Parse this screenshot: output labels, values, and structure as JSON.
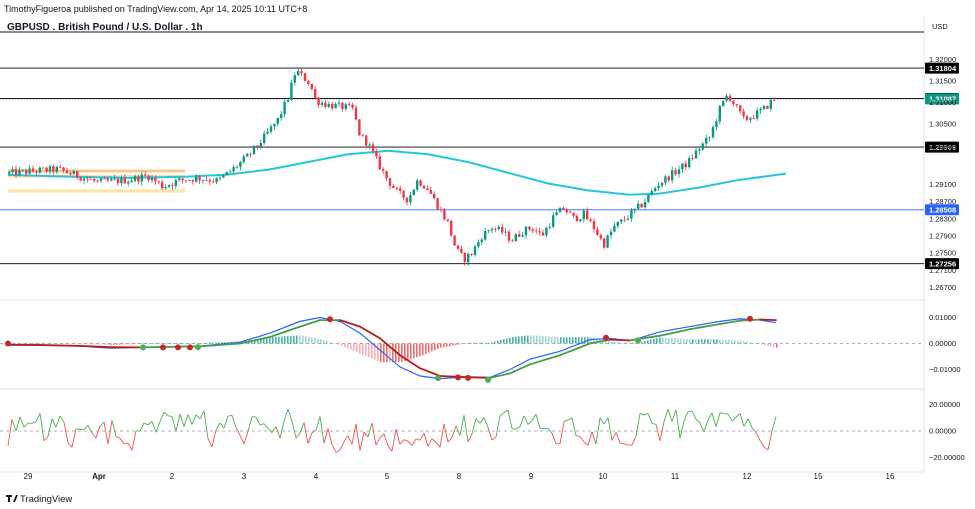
{
  "publisher_text": "TimothyFigueroa published on TradingView.com, Apr 14, 2025 10:11 UTC+8",
  "branding": {
    "logo_text": "TradingView",
    "logo_icon": "tradingview-logo-icon"
  },
  "chart_data": [
    {
      "type": "candlestick",
      "title": "GBPUSD . British Pound / U.S. Dollar . 1h",
      "currency_label": "USD",
      "yticks": [
        "1.32000",
        "1.31500",
        "1.31000",
        "1.30500",
        "1.29950",
        "1.29100",
        "1.28700",
        "1.28300",
        "1.27900",
        "1.27500",
        "1.27100",
        "1.26700"
      ],
      "ylim": [
        1.2655,
        1.3255
      ],
      "price_levels": [
        {
          "label": "1.31804",
          "value": 1.31804,
          "style": "horizontal-line",
          "color": "#000000"
        },
        {
          "label": "1.31097",
          "value": 1.31097,
          "style": "horizontal-line",
          "color": "#000000"
        },
        {
          "label": "1.31087",
          "value": 1.31087,
          "style": "current-price",
          "color": "#089981"
        },
        {
          "label": "1.29966",
          "value": 1.29966,
          "style": "horizontal-line",
          "color": "#000000"
        },
        {
          "label": "1.28508",
          "value": 1.28508,
          "style": "horizontal-line",
          "color": "#2962ff"
        },
        {
          "label": "1.27256",
          "value": 1.27256,
          "style": "horizontal-line",
          "color": "#000000"
        }
      ],
      "overlays": {
        "moving_average": {
          "color": "#26c6da",
          "points": [
            [
              0,
              1.2932
            ],
            [
              60,
              1.2928
            ],
            [
              120,
              1.2925
            ],
            [
              180,
              1.2928
            ],
            [
              220,
              1.2933
            ],
            [
              260,
              1.2944
            ],
            [
              300,
              1.2962
            ],
            [
              340,
              1.298
            ],
            [
              380,
              1.2988
            ],
            [
              420,
              1.298
            ],
            [
              460,
              1.2962
            ],
            [
              500,
              1.2937
            ],
            [
              540,
              1.2912
            ],
            [
              580,
              1.2896
            ],
            [
              620,
              1.2886
            ],
            [
              650,
              1.2888
            ],
            [
              690,
              1.2902
            ],
            [
              730,
              1.292
            ],
            [
              778,
              1.2935
            ]
          ]
        },
        "zones": [
          {
            "from": 1.294,
            "to": 1.2942,
            "x0": 8,
            "x1": 185,
            "color": "#f5c281"
          },
          {
            "from": 1.2928,
            "to": 1.293,
            "x0": 8,
            "x1": 185,
            "color": "#f8dca8"
          },
          {
            "from": 1.2893,
            "to": 1.2896,
            "x0": 8,
            "x1": 185,
            "color": "#f9e3a0"
          }
        ]
      },
      "price_path": [
        [
          8,
          1.2935
        ],
        [
          30,
          1.294
        ],
        [
          60,
          1.2945
        ],
        [
          80,
          1.293
        ],
        [
          100,
          1.2915
        ],
        [
          130,
          1.292
        ],
        [
          150,
          1.293
        ],
        [
          165,
          1.2905
        ],
        [
          180,
          1.2918
        ],
        [
          200,
          1.2925
        ],
        [
          220,
          1.2918
        ],
        [
          235,
          1.2945
        ],
        [
          250,
          1.2975
        ],
        [
          265,
          1.3015
        ],
        [
          280,
          1.306
        ],
        [
          290,
          1.311
        ],
        [
          298,
          1.3175
        ],
        [
          305,
          1.316
        ],
        [
          312,
          1.3145
        ],
        [
          318,
          1.3105
        ],
        [
          330,
          1.3095
        ],
        [
          345,
          1.309
        ],
        [
          355,
          1.3085
        ],
        [
          362,
          1.3025
        ],
        [
          370,
          1.3005
        ],
        [
          380,
          1.296
        ],
        [
          390,
          1.292
        ],
        [
          400,
          1.289
        ],
        [
          410,
          1.2875
        ],
        [
          420,
          1.292
        ],
        [
          430,
          1.29
        ],
        [
          440,
          1.286
        ],
        [
          450,
          1.282
        ],
        [
          458,
          1.276
        ],
        [
          466,
          1.2735
        ],
        [
          474,
          1.275
        ],
        [
          484,
          1.279
        ],
        [
          494,
          1.281
        ],
        [
          504,
          1.28
        ],
        [
          514,
          1.278
        ],
        [
          524,
          1.28
        ],
        [
          534,
          1.281
        ],
        [
          544,
          1.279
        ],
        [
          556,
          1.2835
        ],
        [
          566,
          1.2855
        ],
        [
          576,
          1.283
        ],
        [
          586,
          1.284
        ],
        [
          596,
          1.281
        ],
        [
          606,
          1.277
        ],
        [
          616,
          1.281
        ],
        [
          630,
          1.2835
        ],
        [
          645,
          1.2865
        ],
        [
          660,
          1.291
        ],
        [
          675,
          1.2935
        ],
        [
          690,
          1.296
        ],
        [
          700,
          1.299
        ],
        [
          712,
          1.302
        ],
        [
          722,
          1.3085
        ],
        [
          730,
          1.312
        ],
        [
          738,
          1.309
        ],
        [
          746,
          1.306
        ],
        [
          756,
          1.307
        ],
        [
          766,
          1.3085
        ],
        [
          776,
          1.3108
        ]
      ]
    },
    {
      "type": "macd",
      "yticks": [
        "0.01000",
        "0.00000",
        "−0.01000"
      ],
      "ylim": [
        -0.0148,
        0.0148
      ],
      "macd_line": [
        [
          8,
          -0.0005
        ],
        [
          40,
          -0.0005
        ],
        [
          80,
          -0.001
        ],
        [
          110,
          -0.0018
        ],
        [
          140,
          -0.0015
        ],
        [
          170,
          -0.0012
        ],
        [
          200,
          -0.001
        ],
        [
          240,
          0.0005
        ],
        [
          270,
          0.004
        ],
        [
          300,
          0.0085
        ],
        [
          320,
          0.01
        ],
        [
          340,
          0.0085
        ],
        [
          360,
          0.004
        ],
        [
          380,
          -0.0025
        ],
        [
          400,
          -0.009
        ],
        [
          420,
          -0.0125
        ],
        [
          440,
          -0.0135
        ],
        [
          470,
          -0.0128
        ],
        [
          490,
          -0.013
        ],
        [
          510,
          -0.01
        ],
        [
          530,
          -0.006
        ],
        [
          560,
          -0.003
        ],
        [
          590,
          0.0015
        ],
        [
          610,
          0.002
        ],
        [
          630,
          0.001
        ],
        [
          660,
          0.0045
        ],
        [
          690,
          0.0065
        ],
        [
          720,
          0.0085
        ],
        [
          740,
          0.0095
        ],
        [
          760,
          0.009
        ],
        [
          776,
          0.008
        ]
      ],
      "signal_line": [
        [
          8,
          -0.0005
        ],
        [
          40,
          -0.0006
        ],
        [
          80,
          -0.0009
        ],
        [
          110,
          -0.0014
        ],
        [
          140,
          -0.0015
        ],
        [
          170,
          -0.0013
        ],
        [
          200,
          -0.0011
        ],
        [
          240,
          0.0
        ],
        [
          270,
          0.0025
        ],
        [
          300,
          0.0065
        ],
        [
          320,
          0.009
        ],
        [
          340,
          0.009
        ],
        [
          360,
          0.0065
        ],
        [
          380,
          0.002
        ],
        [
          400,
          -0.0045
        ],
        [
          420,
          -0.0095
        ],
        [
          440,
          -0.0125
        ],
        [
          470,
          -0.013
        ],
        [
          490,
          -0.0132
        ],
        [
          510,
          -0.0115
        ],
        [
          530,
          -0.008
        ],
        [
          560,
          -0.0045
        ],
        [
          590,
          0.0
        ],
        [
          610,
          0.0015
        ],
        [
          630,
          0.0012
        ],
        [
          660,
          0.003
        ],
        [
          690,
          0.0055
        ],
        [
          720,
          0.0075
        ],
        [
          740,
          0.0088
        ],
        [
          760,
          0.0092
        ],
        [
          776,
          0.009
        ]
      ],
      "cross_markers": [
        {
          "x": 8,
          "value": 0.0,
          "kind": "bearish"
        },
        {
          "x": 143,
          "value": -0.0015,
          "kind": "bullish"
        },
        {
          "x": 163,
          "value": -0.0015,
          "kind": "bearish"
        },
        {
          "x": 178,
          "value": -0.0015,
          "kind": "bearish"
        },
        {
          "x": 190,
          "value": -0.0015,
          "kind": "bearish"
        },
        {
          "x": 198,
          "value": -0.0014,
          "kind": "bullish"
        },
        {
          "x": 330,
          "value": 0.0093,
          "kind": "bearish"
        },
        {
          "x": 438,
          "value": -0.0133,
          "kind": "bullish"
        },
        {
          "x": 458,
          "value": -0.013,
          "kind": "bearish"
        },
        {
          "x": 468,
          "value": -0.0132,
          "kind": "bearish"
        },
        {
          "x": 488,
          "value": -0.014,
          "kind": "bullish"
        },
        {
          "x": 606,
          "value": 0.0022,
          "kind": "bearish"
        },
        {
          "x": 638,
          "value": 0.0012,
          "kind": "bullish"
        },
        {
          "x": 750,
          "value": 0.0095,
          "kind": "bearish"
        }
      ]
    },
    {
      "type": "oscillator",
      "yticks": [
        "20.00000",
        "0.00000",
        "−20.00000"
      ],
      "ylim": [
        -27,
        27
      ],
      "seed": 17
    }
  ],
  "x_axis": {
    "ticks": [
      {
        "label": "29",
        "x": 28
      },
      {
        "label": "Apr",
        "x": 99
      },
      {
        "label": "2",
        "x": 172
      },
      {
        "label": "3",
        "x": 244
      },
      {
        "label": "4",
        "x": 316
      },
      {
        "label": "5",
        "x": 387
      },
      {
        "label": "8",
        "x": 459
      },
      {
        "label": "9",
        "x": 531
      },
      {
        "label": "10",
        "x": 603
      },
      {
        "label": "11",
        "x": 675
      },
      {
        "label": "12",
        "x": 747
      },
      {
        "label": "15",
        "x": 818
      },
      {
        "label": "16",
        "x": 890
      }
    ]
  },
  "colors": {
    "up": "#089981",
    "down": "#f23645",
    "macd": "#2962ff",
    "signal_up": "#43a047",
    "signal_down": "#b71c1c",
    "osc_up": "#4caf50",
    "osc_down": "#ef5350"
  }
}
